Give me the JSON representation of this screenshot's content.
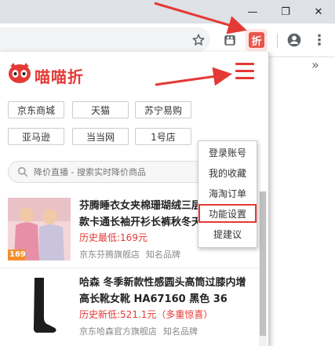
{
  "window": {
    "minimize_glyph": "—",
    "restore_glyph": "❐",
    "close_glyph": "✕"
  },
  "toolbar": {
    "bookmark_icon": "star-icon",
    "extensions_icon": "puzzle-icon",
    "ext_badge": "折",
    "profile_icon": "account-icon",
    "menu_glyph": "⋮",
    "more_glyph": "»"
  },
  "popup": {
    "app_name": "喵喵折",
    "stores": [
      "京东商城",
      "天猫",
      "苏宁易购",
      "亚马逊",
      "当当网",
      "1号店"
    ],
    "search": {
      "placeholder": "降价直播 - 搜索实时降价商品"
    },
    "menu_items": [
      "登录账号",
      "我的收藏",
      "海淘订单",
      "功能设置",
      "提建议"
    ],
    "selected_menu_item": "功能设置",
    "products": [
      {
        "title": "芬腾睡衣女夹棉珊瑚绒三层加厚冬季新款卡通长袖开衫长裤秋冬天新",
        "price": "历史最低:169元",
        "shop": "京东芬腾旗舰店",
        "tag": "知名品牌",
        "thumb_label": "169"
      },
      {
        "title": "哈森 冬季新款性感圆头高筒过膝内增高长靴女靴 HA67160 黑色 36",
        "price": "历史新低:521.1元（多重惊喜）",
        "shop": "京东哈森官方旗舰店",
        "tag": "知名品牌",
        "thumb_label": ""
      }
    ]
  },
  "colors": {
    "accent": "#e53935",
    "annotation_arrow": "#e53935"
  }
}
